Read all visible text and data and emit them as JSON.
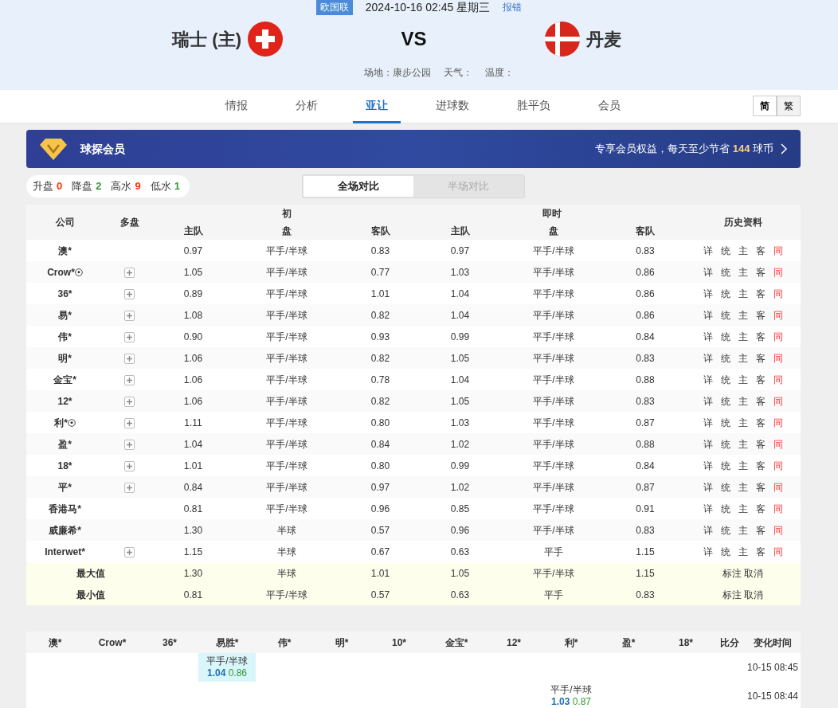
{
  "match": {
    "league": "欧国联",
    "datetime": "2024-10-16 02:45 星期三",
    "report_link": "报错",
    "home": {
      "name": "瑞士 (主)"
    },
    "vs": "VS",
    "away": {
      "name": "丹麦"
    },
    "info": [
      "场地：康步公园",
      "天气：",
      "温度："
    ]
  },
  "nav_tabs": [
    {
      "label": "情报",
      "selected": false
    },
    {
      "label": "分析",
      "selected": false
    },
    {
      "label": "亚让",
      "selected": true
    },
    {
      "label": "进球数",
      "selected": false
    },
    {
      "label": "胜平负",
      "selected": false
    },
    {
      "label": "会员",
      "selected": false
    }
  ],
  "script_toggle": [
    {
      "label": "简",
      "selected": true
    },
    {
      "label": "繁",
      "selected": false
    }
  ],
  "member_banner": {
    "title": "球探会员",
    "text_before": "专享会员权益，每天至少节省",
    "amount": "144",
    "text_after": "球币"
  },
  "stats": [
    {
      "label": "升盘",
      "value": "0",
      "color": "#ff3300"
    },
    {
      "label": "降盘",
      "value": "2",
      "color": "#339933"
    },
    {
      "label": "高水",
      "value": "9",
      "color": "#ff3300"
    },
    {
      "label": "低水",
      "value": "1",
      "color": "#339933"
    }
  ],
  "compare_tabs": [
    {
      "label": "全场对比",
      "selected": true
    },
    {
      "label": "半场对比",
      "selected": false
    }
  ],
  "odds_table": {
    "headers": {
      "company": "公司",
      "multi": "多盘",
      "initial": "初",
      "live": "即时",
      "history": "历史资料",
      "initial_home": "主队",
      "initial_line": "盘",
      "initial_away": "客队",
      "live_home": "主队",
      "live_line": "盘",
      "live_away": "客队"
    },
    "rows": [
      {
        "company": "澳*",
        "multi": false,
        "ball": false,
        "cells": [
          "0.97",
          "平手/半球",
          "0.83",
          "0.97",
          "平手/半球",
          "0.83"
        ],
        "history": [
          "详",
          "统",
          "主",
          "客",
          "同"
        ]
      },
      {
        "company": "Crow*",
        "multi": true,
        "ball": true,
        "cells": [
          "1.05",
          "平手/半球",
          "0.77",
          "1.03",
          "平手/半球",
          "0.86"
        ],
        "history": [
          "详",
          "统",
          "主",
          "客",
          "同"
        ]
      },
      {
        "company": "36*",
        "multi": true,
        "ball": false,
        "cells": [
          "0.89",
          "平手/半球",
          "1.01",
          "1.04",
          "平手/半球",
          "0.86"
        ],
        "history": [
          "详",
          "统",
          "主",
          "客",
          "同"
        ]
      },
      {
        "company": "易*",
        "multi": true,
        "ball": false,
        "cells": [
          "1.08",
          "平手/半球",
          "0.82",
          "1.04",
          "平手/半球",
          "0.86"
        ],
        "history": [
          "详",
          "统",
          "主",
          "客",
          "同"
        ]
      },
      {
        "company": "伟*",
        "multi": true,
        "ball": false,
        "cells": [
          "0.90",
          "平手/半球",
          "0.93",
          "0.99",
          "平手/半球",
          "0.84"
        ],
        "history": [
          "详",
          "统",
          "主",
          "客",
          "同"
        ]
      },
      {
        "company": "明*",
        "multi": true,
        "ball": false,
        "cells": [
          "1.06",
          "平手/半球",
          "0.82",
          "1.05",
          "平手/半球",
          "0.83"
        ],
        "history": [
          "详",
          "统",
          "主",
          "客",
          "同"
        ]
      },
      {
        "company": "金宝*",
        "multi": true,
        "ball": false,
        "cells": [
          "1.06",
          "平手/半球",
          "0.78",
          "1.04",
          "平手/半球",
          "0.88"
        ],
        "history": [
          "详",
          "统",
          "主",
          "客",
          "同"
        ]
      },
      {
        "company": "12*",
        "multi": true,
        "ball": false,
        "cells": [
          "1.06",
          "平手/半球",
          "0.82",
          "1.05",
          "平手/半球",
          "0.83"
        ],
        "history": [
          "详",
          "统",
          "主",
          "客",
          "同"
        ]
      },
      {
        "company": "利*",
        "multi": true,
        "ball": true,
        "cells": [
          "1.11",
          "平手/半球",
          "0.80",
          "1.03",
          "平手/半球",
          "0.87"
        ],
        "history": [
          "详",
          "统",
          "主",
          "客",
          "同"
        ]
      },
      {
        "company": "盈*",
        "multi": true,
        "ball": false,
        "cells": [
          "1.04",
          "平手/半球",
          "0.84",
          "1.02",
          "平手/半球",
          "0.88"
        ],
        "history": [
          "详",
          "统",
          "主",
          "客",
          "同"
        ]
      },
      {
        "company": "18*",
        "multi": true,
        "ball": false,
        "cells": [
          "1.01",
          "平手/半球",
          "0.80",
          "0.99",
          "平手/半球",
          "0.84"
        ],
        "history": [
          "详",
          "统",
          "主",
          "客",
          "同"
        ]
      },
      {
        "company": "平*",
        "multi": true,
        "ball": false,
        "cells": [
          "0.84",
          "平手/半球",
          "0.97",
          "1.02",
          "平手/半球",
          "0.87"
        ],
        "history": [
          "详",
          "统",
          "主",
          "客",
          "同"
        ]
      },
      {
        "company": "香港马*",
        "multi": false,
        "ball": false,
        "cells": [
          "0.81",
          "平手/半球",
          "0.96",
          "0.85",
          "平手/半球",
          "0.91"
        ],
        "history": [
          "详",
          "统",
          "主",
          "客",
          "同"
        ]
      },
      {
        "company": "威廉希*",
        "multi": false,
        "ball": false,
        "cells": [
          "1.30",
          "半球",
          "0.57",
          "0.96",
          "平手/半球",
          "0.83"
        ],
        "history": [
          "详",
          "统",
          "主",
          "客",
          "同"
        ]
      },
      {
        "company": "Interwet*",
        "multi": true,
        "ball": false,
        "cells": [
          "1.15",
          "半球",
          "0.67",
          "0.63",
          "平手",
          "1.15"
        ],
        "history": [
          "详",
          "统",
          "主",
          "客",
          "同"
        ]
      }
    ],
    "summary": [
      {
        "label": "最大值",
        "cells": [
          "1.30",
          "半球",
          "1.01",
          "1.05",
          "平手/半球",
          "1.15"
        ],
        "actions": "标注 取消"
      },
      {
        "label": "最小值",
        "cells": [
          "0.81",
          "平手/半球",
          "0.57",
          "0.63",
          "平手",
          "0.83"
        ],
        "actions": "标注 取消"
      }
    ]
  },
  "change_table": {
    "columns": [
      "澳*",
      "Crow*",
      "36*",
      "易胜*",
      "伟*",
      "明*",
      "10*",
      "金宝*",
      "12*",
      "利*",
      "盈*",
      "18*",
      "比分",
      "变化时间"
    ],
    "rows": [
      {
        "cells": [
          null,
          null,
          null,
          {
            "highlighted": true,
            "line": "平手/半球",
            "home": "1.04",
            "away": "0.86"
          },
          null,
          null,
          null,
          null,
          null,
          null,
          null,
          null,
          null
        ],
        "time": "10-15 08:45"
      },
      {
        "cells": [
          null,
          null,
          null,
          null,
          null,
          null,
          null,
          null,
          null,
          {
            "highlighted": false,
            "line": "平手/半球",
            "home": "1.03",
            "away": "0.87"
          },
          null,
          null,
          null
        ],
        "time": "10-15 08:44"
      }
    ]
  }
}
